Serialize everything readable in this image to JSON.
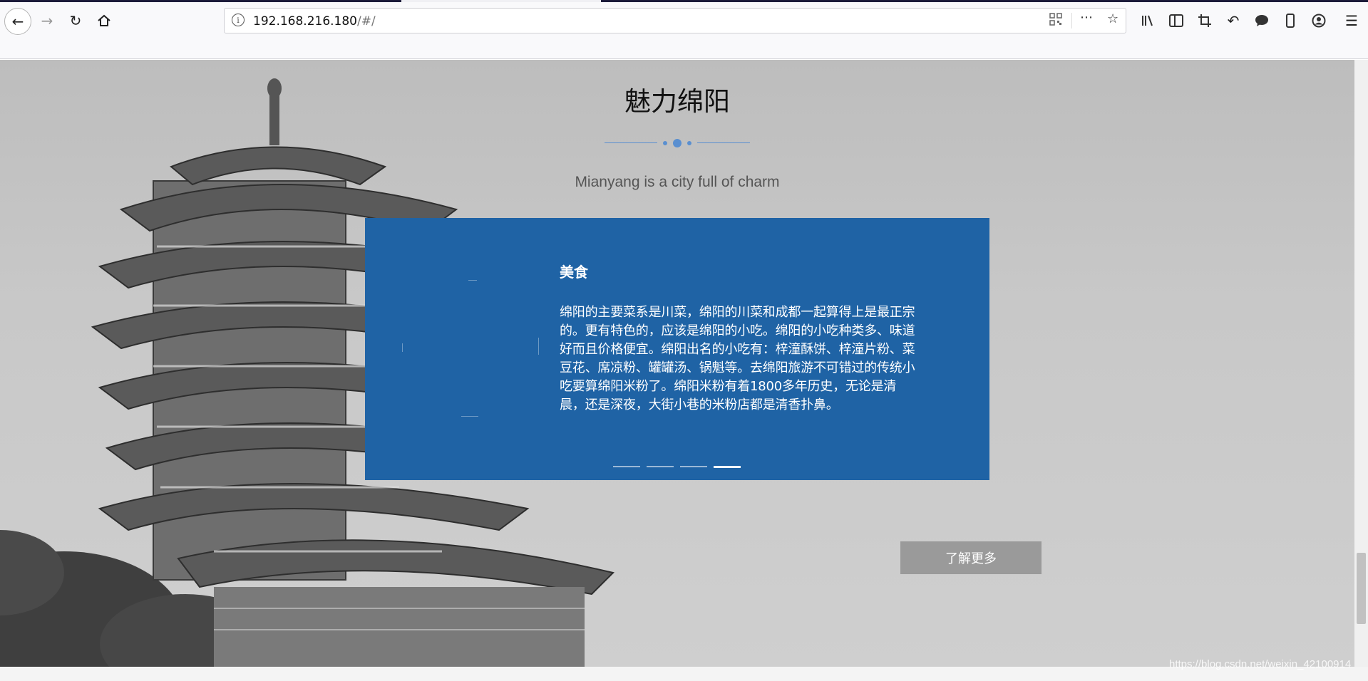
{
  "browser": {
    "url_host": "192.168.216.180",
    "url_path": "/#/"
  },
  "section": {
    "title": "魅力绵阳",
    "subtitle": "Mianyang is a city full of charm"
  },
  "carousel": {
    "active_index": 3,
    "slide_count": 4,
    "slide": {
      "title": "美食",
      "body": "绵阳的主要菜系是川菜，绵阳的川菜和成都一起算得上是最正宗的。更有特色的，应该是绵阳的小吃。绵阳的小吃种类多、味道好而且价格便宜。绵阳出名的小吃有：梓潼酥饼、梓潼片粉、菜豆花、席凉粉、罐罐汤、锅魁等。去绵阳旅游不可错过的传统小吃要算绵阳米粉了。绵阳米粉有着1800多年历史，无论是清晨，还是深夜，大街小巷的米粉店都是清香扑鼻。"
    }
  },
  "buttons": {
    "learn_more": "了解更多"
  },
  "watermark": "https://blog.csdn.net/weixin_42100914",
  "colors": {
    "card_bg": "#1f63a5",
    "accent_line": "#5a8fd0",
    "button_bg": "#9a9a9a"
  }
}
